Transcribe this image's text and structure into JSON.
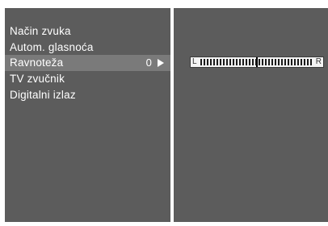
{
  "menu": {
    "items": [
      {
        "label": "Način zvuka"
      },
      {
        "label": "Autom. glasnoća"
      },
      {
        "label": "Ravnoteža",
        "value": "0",
        "selected": true
      },
      {
        "label": "TV zvučnik"
      },
      {
        "label": "Digitalni izlaz"
      }
    ]
  },
  "balance": {
    "left_label": "L",
    "right_label": "R",
    "level_fraction": 0.5
  },
  "colors": {
    "panel": "#5c5c5c",
    "selected": "#7a7a7a",
    "text": "#ffffff"
  }
}
